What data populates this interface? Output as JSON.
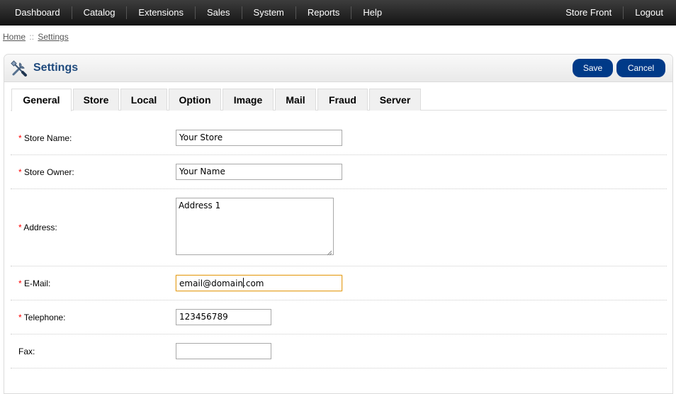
{
  "nav": {
    "left": [
      "Dashboard",
      "Catalog",
      "Extensions",
      "Sales",
      "System",
      "Reports",
      "Help"
    ],
    "right": [
      "Store Front",
      "Logout"
    ]
  },
  "breadcrumb": {
    "home": "Home",
    "separator": "::",
    "current": "Settings"
  },
  "heading": {
    "title": "Settings",
    "icon": "settings-tools-icon"
  },
  "buttons": {
    "save": "Save",
    "cancel": "Cancel"
  },
  "tabs": [
    "General",
    "Store",
    "Local",
    "Option",
    "Image",
    "Mail",
    "Fraud",
    "Server"
  ],
  "active_tab": "General",
  "form": {
    "required_marker": "*",
    "store_name": {
      "label": "Store Name:",
      "value": "Your Store",
      "required": true
    },
    "store_owner": {
      "label": "Store Owner:",
      "value": "Your Name",
      "required": true
    },
    "address": {
      "label": "Address:",
      "value": "Address 1",
      "required": true
    },
    "email": {
      "label": "E-Mail:",
      "value_before_caret": "email@domain",
      "value_after_caret": ".com",
      "required": true
    },
    "telephone": {
      "label": "Telephone:",
      "value": "123456789",
      "required": true
    },
    "fax": {
      "label": "Fax:",
      "value": "",
      "required": false
    }
  },
  "colors": {
    "topbar": "#1e1e1e",
    "button": "#003a88",
    "heading_text": "#1f4a7d",
    "required": "#ff0000",
    "focus_border": "#e5a227"
  }
}
